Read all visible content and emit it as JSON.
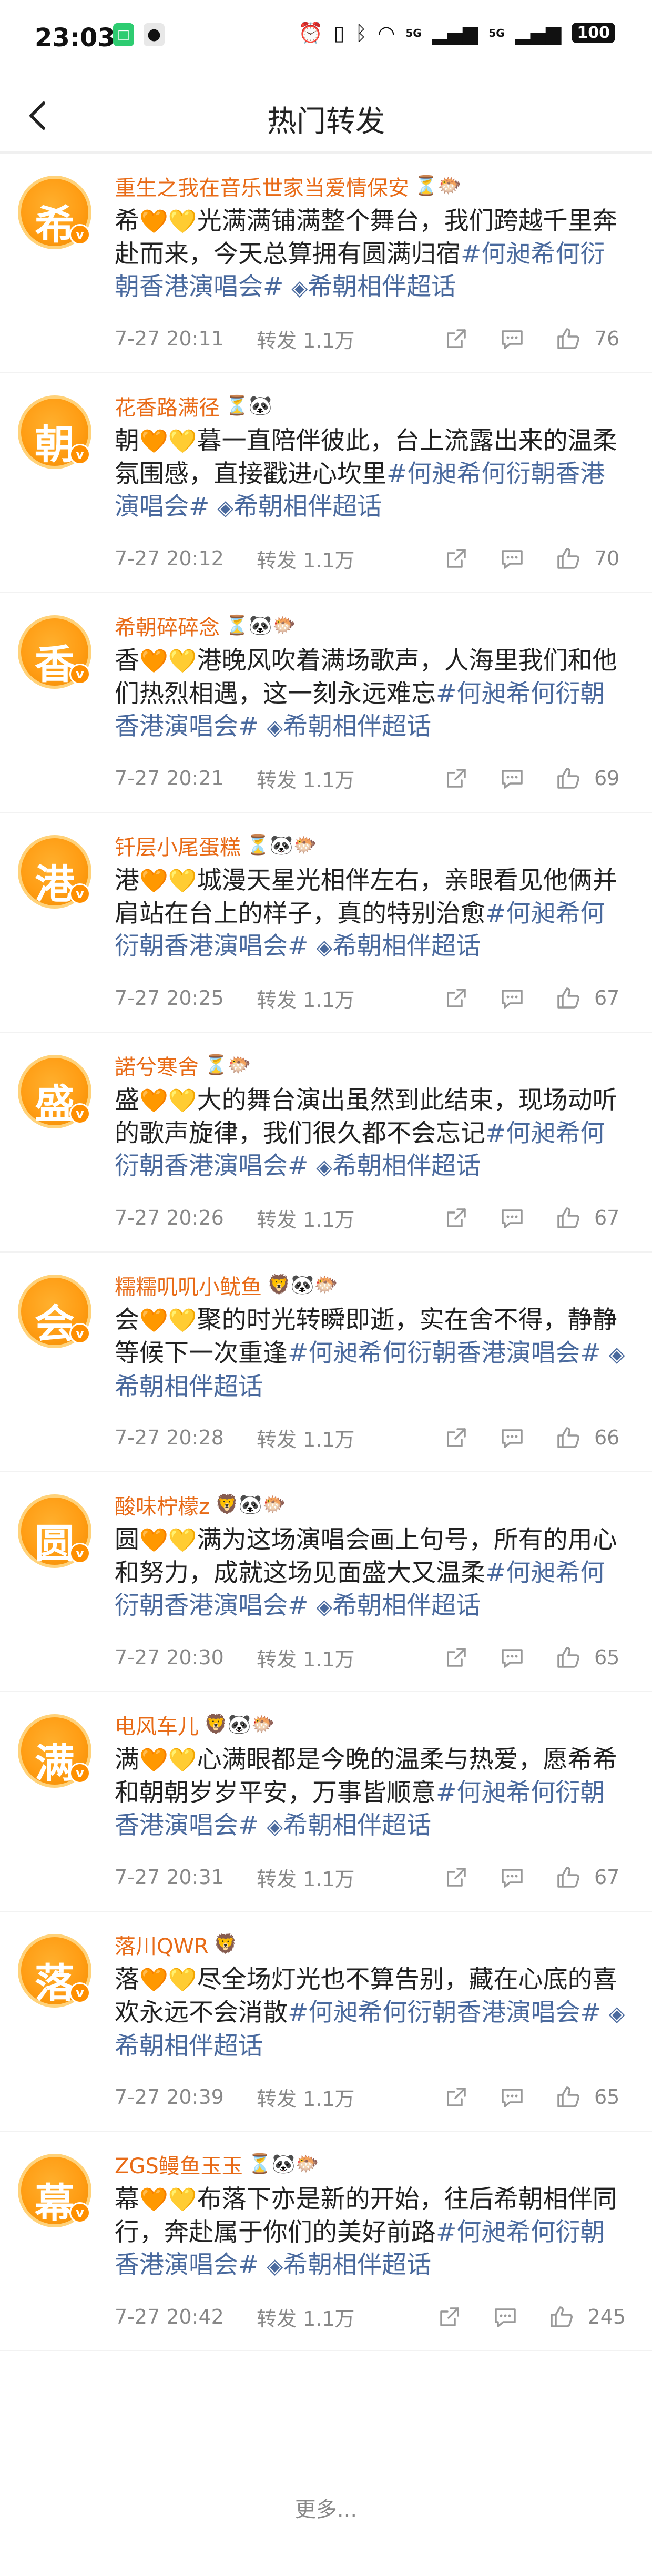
{
  "status": {
    "time": "23:03",
    "battery": "100",
    "signal1": "5G",
    "signal2": "5G"
  },
  "header": {
    "title": "热门转发",
    "back_icon": "chevron-left-icon"
  },
  "colors": {
    "username": "#e86b17",
    "topic": "#4a6a9e",
    "avatar": "#ff9d14"
  },
  "items": [
    {
      "avatar_char": "希",
      "username": "重生之我在音乐世家当爱情保安",
      "badges": "⏳🐡",
      "lead": "希",
      "body": "光满满铺满整个舞台，我们跨越千里奔赴而来，今天总算拥有圆满归宿",
      "tag1": "#何昶希何衍朝香港演唱会#",
      "tag2": "希朝相伴超话",
      "time": "7-27 20:11",
      "repost": "转发 1.1万",
      "likes": "76"
    },
    {
      "avatar_char": "朝",
      "username": "花香路满径",
      "badges": "⏳🐼",
      "lead": "朝",
      "body": "暮一直陪伴彼此，台上流露出来的温柔氛围感，直接戳进心坎里",
      "tag1": "#何昶希何衍朝香港演唱会#",
      "tag2": "希朝相伴超话",
      "time": "7-27 20:12",
      "repost": "转发 1.1万",
      "likes": "70"
    },
    {
      "avatar_char": "香",
      "username": "希朝碎碎念",
      "badges": "⏳🐼🐡",
      "lead": "香",
      "body": "港晚风吹着满场歌声，人海里我们和他们热烈相遇，这一刻永远难忘",
      "tag1": "#何昶希何衍朝香港演唱会#",
      "tag2": "希朝相伴超话",
      "time": "7-27 20:21",
      "repost": "转发 1.1万",
      "likes": "69"
    },
    {
      "avatar_char": "港",
      "username": "钎层小尾蛋糕",
      "badges": "⏳🐼🐡",
      "lead": "港",
      "body": "城漫天星光相伴左右，亲眼看见他俩并肩站在台上的样子，真的特别治愈",
      "tag1": "#何昶希何衍朝香港演唱会#",
      "tag2": "希朝相伴超话",
      "time": "7-27 20:25",
      "repost": "转发 1.1万",
      "likes": "67"
    },
    {
      "avatar_char": "盛",
      "username": "諾兮寒舍",
      "badges": "⏳🐡",
      "lead": "盛",
      "body": "大的舞台演出虽然到此结束，现场动听的歌声旋律，我们很久都不会忘记",
      "tag1": "#何昶希何衍朝香港演唱会#",
      "tag2": "希朝相伴超话",
      "time": "7-27 20:26",
      "repost": "转发 1.1万",
      "likes": "67"
    },
    {
      "avatar_char": "会",
      "username": "糯糯叽叽小鱿鱼",
      "badges": "🦁🐼🐡",
      "lead": "会",
      "body": "聚的时光转瞬即逝，实在舍不得，静静等候下一次重逢",
      "tag1": "#何昶希何衍朝香港演唱会#",
      "tag2": "希朝相伴超话",
      "time": "7-27 20:28",
      "repost": "转发 1.1万",
      "likes": "66"
    },
    {
      "avatar_char": "圆",
      "username": "酸味柠檬z",
      "badges": "🦁🐼🐡",
      "lead": "圆",
      "body": "满为这场演唱会画上句号，所有的用心和努力，成就这场见面盛大又温柔",
      "tag1": "#何昶希何衍朝香港演唱会#",
      "tag2": "希朝相伴超话",
      "time": "7-27 20:30",
      "repost": "转发 1.1万",
      "likes": "65"
    },
    {
      "avatar_char": "满",
      "username": "电风车儿",
      "badges": "🦁🐼🐡",
      "lead": "满",
      "body": "心满眼都是今晚的温柔与热爱，愿希希和朝朝岁岁平安，万事皆顺意",
      "tag1": "#何昶希何衍朝香港演唱会#",
      "tag2": "希朝相伴超话",
      "time": "7-27 20:31",
      "repost": "转发 1.1万",
      "likes": "67"
    },
    {
      "avatar_char": "落",
      "username": "落川QWR",
      "badges": "🦁",
      "lead": "落",
      "body": "尽全场灯光也不算告别，藏在心底的喜欢永远不会消散",
      "tag1": "#何昶希何衍朝香港演唱会#",
      "tag2": "希朝相伴超话",
      "time": "7-27 20:39",
      "repost": "转发 1.1万",
      "likes": "65"
    },
    {
      "avatar_char": "幕",
      "username": "ZGS鳗鱼玉玉",
      "badges": "⏳🐼🐡",
      "lead": "幕",
      "body": "布落下亦是新的开始，往后希朝相伴同行，奔赴属于你们的美好前路",
      "tag1": "#何昶希何衍朝香港演唱会#",
      "tag2": "希朝相伴超话",
      "time": "7-27 20:42",
      "repost": "转发 1.1万",
      "likes": "245"
    }
  ],
  "footer": {
    "more_label": "更多..."
  }
}
